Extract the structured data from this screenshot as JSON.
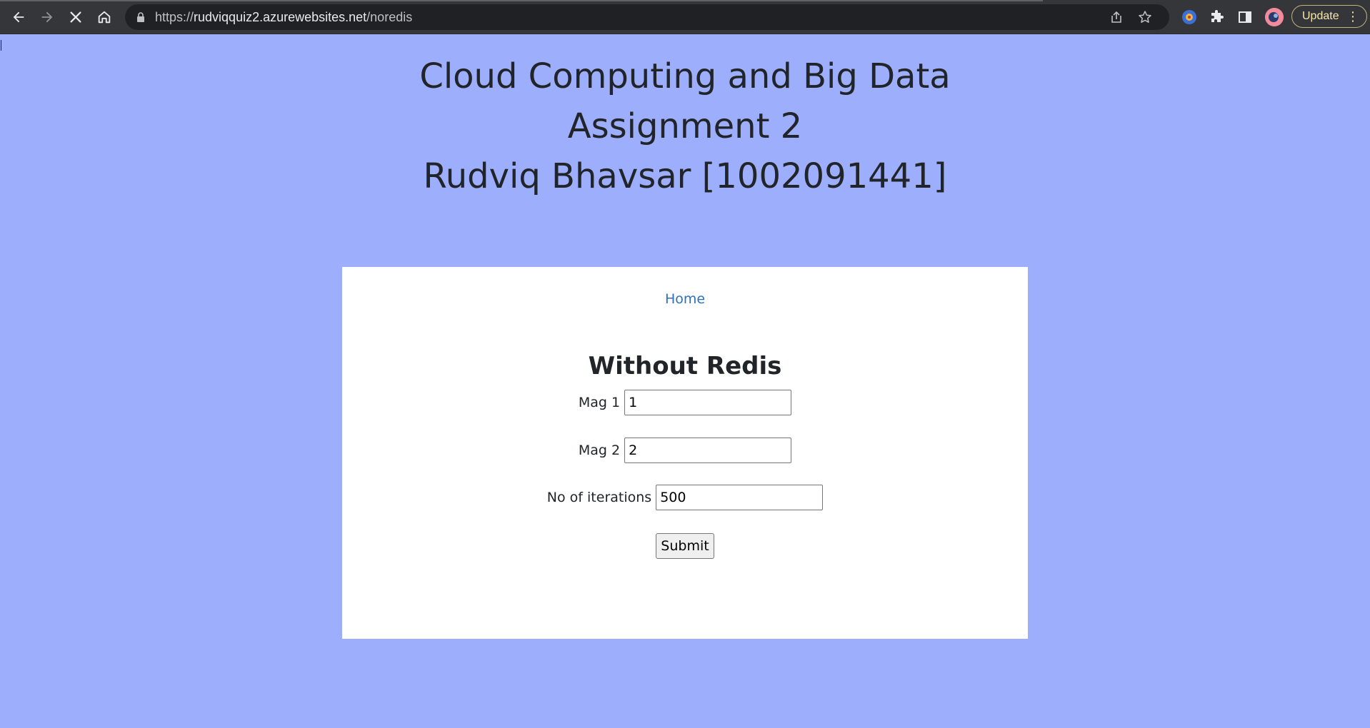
{
  "browser": {
    "url_scheme": "https://",
    "url_host": "rudviqquiz2.azurewebsites.net",
    "url_path": "/noredis",
    "update_label": "Update",
    "menu_glyph": "⋮",
    "icons": [
      "back-icon",
      "forward-icon",
      "stop-icon",
      "home-icon",
      "lock-icon",
      "share-icon",
      "star-icon",
      "extension-icon",
      "puzzle-icon",
      "side-panel-icon",
      "profile-avatar"
    ]
  },
  "header": {
    "line1": "Cloud Computing and Big Data",
    "line2": "Assignment 2",
    "line3": "Rudviq Bhavsar [1002091441]"
  },
  "card": {
    "home_link": "Home",
    "title": "Without Redis",
    "fields": [
      {
        "label": "Mag 1",
        "value": "1"
      },
      {
        "label": "Mag 2",
        "value": "2"
      },
      {
        "label": "No of iterations",
        "value": "500"
      }
    ],
    "submit_label": "Submit"
  },
  "colors": {
    "page_background": "#9daffc",
    "card_background": "#ffffff",
    "link": "#2f6fbe",
    "chrome": "#35363a"
  }
}
